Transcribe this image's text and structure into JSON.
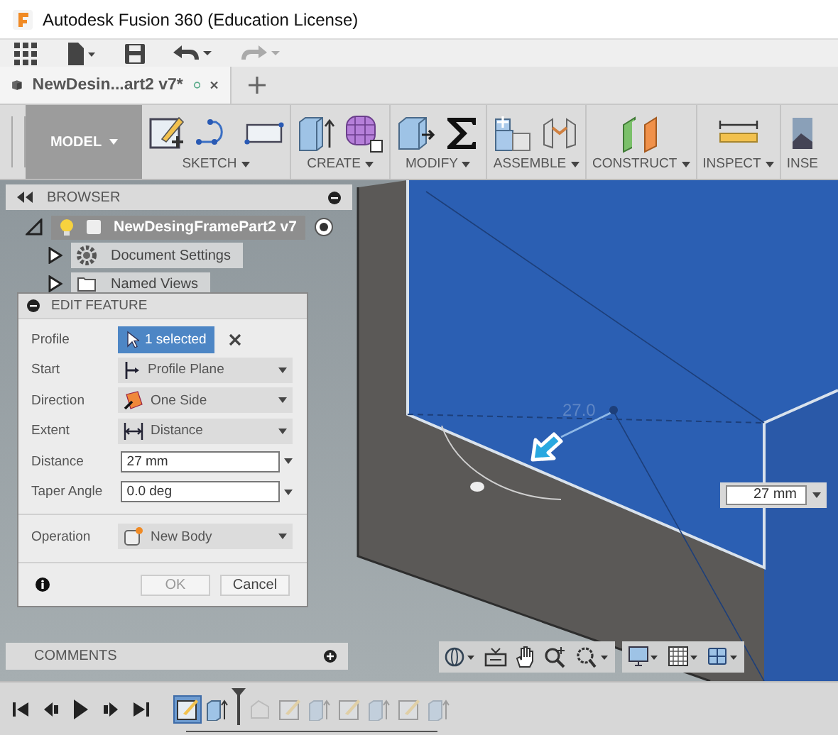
{
  "window": {
    "title": "Autodesk Fusion 360 (Education License)"
  },
  "document_tab": {
    "title": "NewDesin...art2 v7*"
  },
  "ribbon": {
    "workspace": "MODEL",
    "groups": [
      {
        "label": "SKETCH",
        "dropdown": true
      },
      {
        "label": "CREATE",
        "dropdown": true
      },
      {
        "label": "MODIFY",
        "dropdown": true
      },
      {
        "label": "ASSEMBLE",
        "dropdown": true
      },
      {
        "label": "CONSTRUCT",
        "dropdown": true
      },
      {
        "label": "INSPECT",
        "dropdown": true
      },
      {
        "label": "INSE",
        "dropdown": false
      }
    ]
  },
  "browser": {
    "title": "BROWSER",
    "items": [
      {
        "label": "NewDesingFramePart2 v7",
        "expanded": true,
        "selected": true,
        "children": [
          {
            "label": "Document Settings",
            "expanded": false,
            "selected": false
          },
          {
            "label": "Named Views",
            "expanded": false,
            "selected": false
          }
        ]
      }
    ]
  },
  "edit_feature": {
    "title": "EDIT FEATURE",
    "rows": [
      {
        "kind": "selection",
        "label": "Profile",
        "value": "1 selected"
      },
      {
        "kind": "dropdown",
        "label": "Start",
        "value": "Profile Plane"
      },
      {
        "kind": "dropdown",
        "label": "Direction",
        "value": "One Side"
      },
      {
        "kind": "dropdown",
        "label": "Extent",
        "value": "Distance"
      },
      {
        "kind": "input",
        "label": "Distance",
        "value": "27 mm"
      },
      {
        "kind": "input",
        "label": "Taper Angle",
        "value": "0.0 deg"
      }
    ],
    "operation": {
      "label": "Operation",
      "value": "New Body"
    },
    "buttons": [
      "OK",
      "Cancel"
    ]
  },
  "viewport": {
    "dimension_label": "27.0",
    "distance_field": "27 mm"
  },
  "comments": {
    "title": "COMMENTS"
  },
  "timeline": {
    "steps": [
      {
        "kind": "sketch",
        "selected": true,
        "rolled_back": false
      },
      {
        "kind": "extrude",
        "selected": false,
        "rolled_back": false
      },
      {
        "kind": "fillet",
        "selected": false,
        "rolled_back": true
      },
      {
        "kind": "sketch",
        "selected": false,
        "rolled_back": true
      },
      {
        "kind": "extrude",
        "selected": false,
        "rolled_back": true
      },
      {
        "kind": "sketch",
        "selected": false,
        "rolled_back": true
      },
      {
        "kind": "extrude",
        "selected": false,
        "rolled_back": true
      },
      {
        "kind": "sketch",
        "selected": false,
        "rolled_back": true
      },
      {
        "kind": "extrude",
        "selected": false,
        "rolled_back": true
      }
    ]
  }
}
